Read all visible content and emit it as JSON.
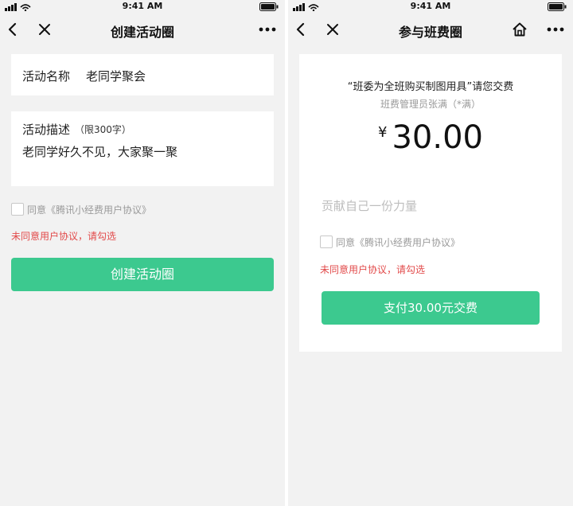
{
  "status_bar": {
    "time": "9:41 AM"
  },
  "left": {
    "title": "创建活动圈",
    "name_label": "活动名称",
    "name_value": "老同学聚会",
    "desc_label": "活动描述",
    "desc_limit": "（限300字）",
    "desc_value": "老同学好久不见，大家聚一聚",
    "agree_text": "同意《腾讯小经费用户协议》",
    "warn_text": "未同意用户协议，请勾选",
    "button_label": "创建活动圈"
  },
  "right": {
    "title": "参与班费圈",
    "pay_title": "“班委为全班购买制图用具”请您交费",
    "manager_text": "班费管理员张满（*满）",
    "currency": "¥",
    "amount": "30.00",
    "contrib_placeholder": "贡献自己一份力量",
    "agree_text": "同意《腾讯小经费用户协议》",
    "warn_text": "未同意用户协议，请勾选",
    "button_label": "支付30.00元交费"
  },
  "icons": {
    "back": "back-chevron-icon",
    "close": "close-icon",
    "more": "more-dots-icon",
    "home": "home-icon",
    "signal": "signal-icon",
    "wifi": "wifi-icon",
    "battery": "battery-icon"
  },
  "colors": {
    "accent": "#3cc98f",
    "warning": "#e24a4a",
    "background": "#f2f2f2"
  }
}
